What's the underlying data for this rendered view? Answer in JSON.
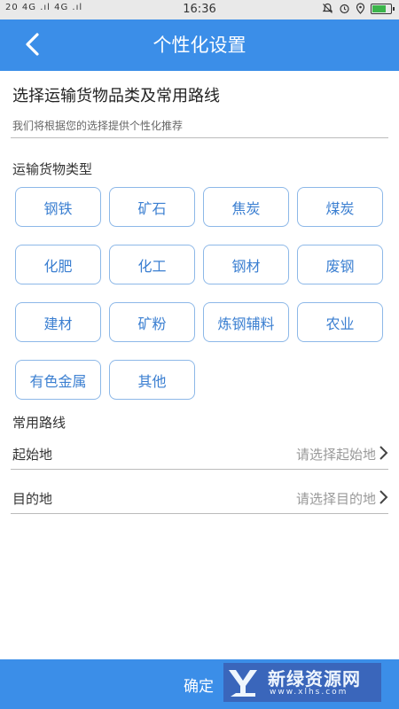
{
  "status_bar": {
    "signal_text": "20 4G .ıl 4G .ıl",
    "time": "16:36",
    "icons": [
      "bell-off-icon",
      "alarm-icon",
      "location-icon",
      "battery-icon"
    ]
  },
  "header": {
    "title": "个性化设置",
    "back_icon": "chevron-left-icon"
  },
  "intro": {
    "title": "选择运输货物品类及常用路线",
    "subtitle": "我们将根据您的选择提供个性化推荐"
  },
  "cargo": {
    "label": "运输货物类型",
    "options": [
      "钢铁",
      "矿石",
      "焦炭",
      "煤炭",
      "化肥",
      "化工",
      "钢材",
      "废钢",
      "建材",
      "矿粉",
      "炼钢辅料",
      "农业",
      "有色金属",
      "其他"
    ]
  },
  "routes": {
    "label": "常用路线",
    "origin": {
      "label": "起始地",
      "placeholder": "请选择起始地"
    },
    "destination": {
      "label": "目的地",
      "placeholder": "请选择目的地"
    }
  },
  "footer": {
    "confirm_label": "确定"
  },
  "watermark": {
    "name": "新绿资源网",
    "domain": "www.xlhs.com"
  },
  "colors": {
    "primary": "#3b8ee8",
    "chip_border": "#8db8e8",
    "chip_text": "#3b7fd1",
    "watermark_bg": "#3a63b8"
  }
}
